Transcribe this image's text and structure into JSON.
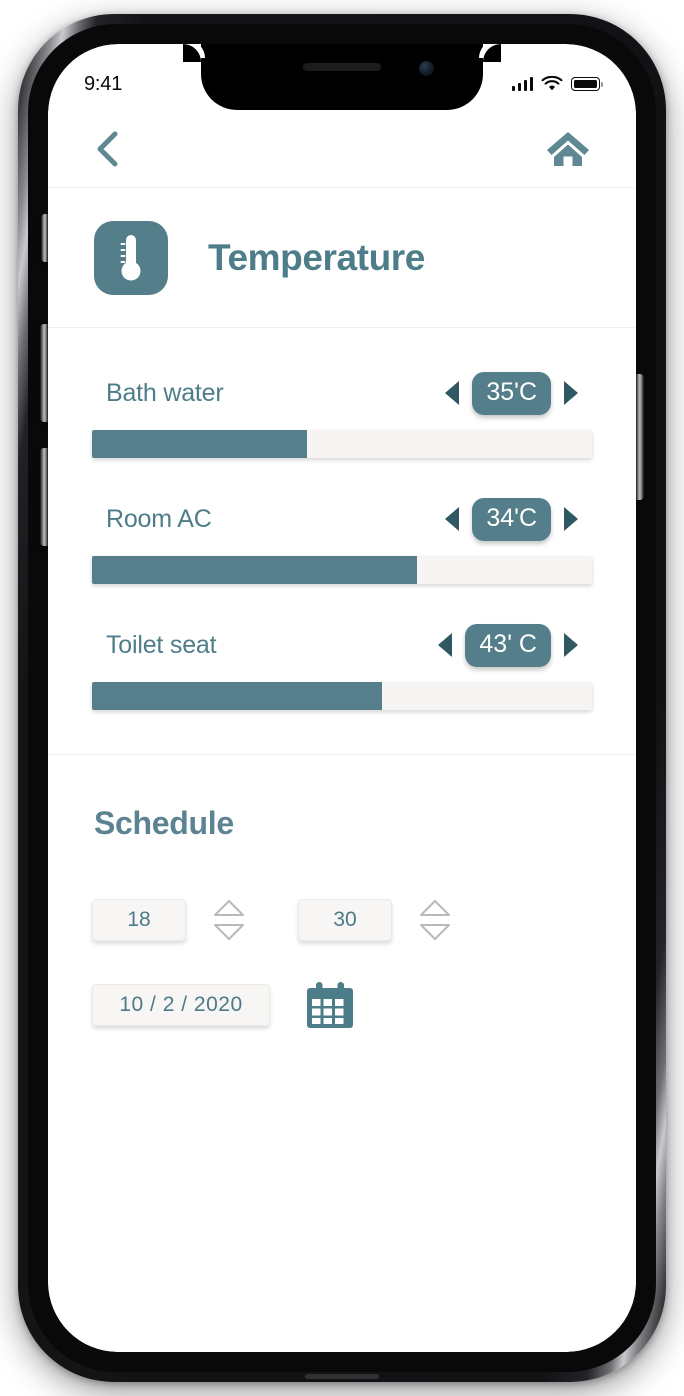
{
  "status_bar": {
    "time": "9:41",
    "signal_icon": "cellular-bars-icon",
    "wifi_icon": "wifi-icon",
    "battery_icon": "battery-full-icon"
  },
  "navbar": {
    "back_icon": "back-chevron-icon",
    "home_icon": "home-icon"
  },
  "header": {
    "icon": "thermometer-icon",
    "title": "Temperature"
  },
  "colors": {
    "accent": "#4e7d8a",
    "accent_fill": "#577f8b",
    "badge": "#537e8a",
    "arrow": "#2f5862",
    "track": "#f6f5f3",
    "field_bg": "#f7f6f4",
    "text_dark": "#0a0a0a"
  },
  "controls": [
    {
      "label": "Bath water",
      "value": "35'C",
      "fill_percent": 43,
      "dec_icon": "triangle-left-icon",
      "inc_icon": "triangle-right-icon"
    },
    {
      "label": "Room AC",
      "value": "34'C",
      "fill_percent": 65,
      "dec_icon": "triangle-left-icon",
      "inc_icon": "triangle-right-icon"
    },
    {
      "label": "Toilet seat",
      "value": "43' C",
      "fill_percent": 58,
      "dec_icon": "triangle-left-icon",
      "inc_icon": "triangle-right-icon"
    }
  ],
  "schedule": {
    "title": "Schedule",
    "hour": "18",
    "minute": "30",
    "date": "10 / 2 / 2020",
    "hour_spinner_icon": "spinner-up-down-icon",
    "minute_spinner_icon": "spinner-up-down-icon",
    "calendar_icon": "calendar-icon"
  }
}
